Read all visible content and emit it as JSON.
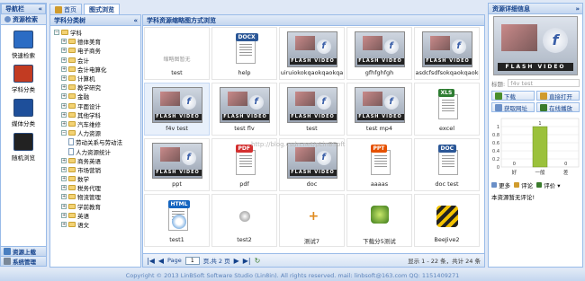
{
  "nav": {
    "title": "导航栏",
    "section": "资源检索",
    "items": [
      {
        "label": "快速检索",
        "color": "#2b6cc4"
      },
      {
        "label": "学科分类",
        "color": "#c23b22"
      },
      {
        "label": "媒体分类",
        "color": "#1e4f9a"
      },
      {
        "label": "随机浏览",
        "color": "#222222"
      }
    ],
    "footer": [
      "资源上载",
      "系统管理"
    ]
  },
  "tabs": [
    {
      "label": "首页"
    },
    {
      "label": "图式浏览"
    }
  ],
  "tree": {
    "title": "学科分类树",
    "nodes": [
      {
        "label": "学科",
        "depth": 0,
        "kind": "folder"
      },
      {
        "label": "德体美育",
        "depth": 1,
        "kind": "folder"
      },
      {
        "label": "电子商务",
        "depth": 1,
        "kind": "folder"
      },
      {
        "label": "会计",
        "depth": 1,
        "kind": "folder"
      },
      {
        "label": "会计电算化",
        "depth": 1,
        "kind": "folder"
      },
      {
        "label": "计算机",
        "depth": 1,
        "kind": "folder"
      },
      {
        "label": "教学研究",
        "depth": 1,
        "kind": "folder"
      },
      {
        "label": "金融",
        "depth": 1,
        "kind": "folder"
      },
      {
        "label": "平面设计",
        "depth": 1,
        "kind": "folder"
      },
      {
        "label": "其他学科",
        "depth": 1,
        "kind": "folder"
      },
      {
        "label": "汽车维修",
        "depth": 1,
        "kind": "folder"
      },
      {
        "label": "人力资源",
        "depth": 1,
        "kind": "folder-open"
      },
      {
        "label": "劳动关系与劳动法",
        "depth": 2,
        "kind": "doc"
      },
      {
        "label": "人力资源统计",
        "depth": 2,
        "kind": "doc"
      },
      {
        "label": "商务英语",
        "depth": 1,
        "kind": "folder"
      },
      {
        "label": "市场营销",
        "depth": 1,
        "kind": "folder"
      },
      {
        "label": "数学",
        "depth": 1,
        "kind": "folder"
      },
      {
        "label": "税务代理",
        "depth": 1,
        "kind": "folder"
      },
      {
        "label": "物流管理",
        "depth": 1,
        "kind": "folder"
      },
      {
        "label": "学前教育",
        "depth": 1,
        "kind": "folder"
      },
      {
        "label": "英语",
        "depth": 1,
        "kind": "folder"
      },
      {
        "label": "语文",
        "depth": 1,
        "kind": "folder"
      }
    ]
  },
  "grid": {
    "title": "学科资源缩略图方式浏览",
    "watermark": "http://blog.csdn.net/pLinBSoft",
    "items": [
      {
        "caption": "test",
        "thumb": "blank",
        "thumb_text": "缩略图暂无"
      },
      {
        "caption": "help",
        "thumb": "docx",
        "thumb_text": "DOCX"
      },
      {
        "caption": "uiruiokokqaokqaokqa",
        "thumb": "flash",
        "thumb_text": "FLASH VIDEO"
      },
      {
        "caption": "gfhfghfgh",
        "thumb": "flash",
        "thumb_text": "FLASH VIDEO"
      },
      {
        "caption": "asdcfsdfsokqaokqaokqa",
        "thumb": "flash",
        "thumb_text": "FLASH VIDEO"
      },
      {
        "caption": "f4v test",
        "thumb": "flash",
        "thumb_text": "FLASH VIDEO",
        "selected": true
      },
      {
        "caption": "test flv",
        "thumb": "flash",
        "thumb_text": "FLASH VIDEO"
      },
      {
        "caption": "test",
        "thumb": "flash",
        "thumb_text": "FLASH VIDEO"
      },
      {
        "caption": "test mp4",
        "thumb": "flash",
        "thumb_text": "FLASH VIDEO"
      },
      {
        "caption": "excel",
        "thumb": "xls",
        "thumb_text": "XLS"
      },
      {
        "caption": "ppt",
        "thumb": "flash",
        "thumb_text": "FLASH VIDEO"
      },
      {
        "caption": "pdf",
        "thumb": "pdf",
        "thumb_text": "PDF"
      },
      {
        "caption": "doc",
        "thumb": "flash",
        "thumb_text": "FLASH VIDEO"
      },
      {
        "caption": "aaaas",
        "thumb": "ppt",
        "thumb_text": "PPT"
      },
      {
        "caption": "doc test",
        "thumb": "doc",
        "thumb_text": "DOC"
      },
      {
        "caption": "test1",
        "thumb": "html",
        "thumb_text": "HTML"
      },
      {
        "caption": "test2",
        "thumb": "ball",
        "thumb_text": ""
      },
      {
        "caption": "测试7",
        "thumb": "plus",
        "thumb_text": ""
      },
      {
        "caption": "下载分5测试",
        "thumb": "app",
        "thumb_text": ""
      },
      {
        "caption": "BeeJive2",
        "thumb": "bee",
        "thumb_text": ""
      }
    ],
    "pager": {
      "page_label": "Page",
      "page_value": "1",
      "of_label": "页,共 2 页",
      "status": "显示 1 - 22 条，共计 24 条"
    }
  },
  "detail": {
    "title": "资源详细信息",
    "preview_text": "FLASH VIDEO",
    "name_label": "标题:",
    "name_value": "f4v test",
    "buttons": [
      {
        "label": "下载"
      },
      {
        "label": "直接打开"
      },
      {
        "label": "获取网址"
      },
      {
        "label": "在线播放"
      }
    ],
    "rating": {
      "categories": [
        "好",
        "一般",
        "差"
      ],
      "values": [
        0,
        1,
        0
      ],
      "ylim": [
        0,
        1.2
      ],
      "ticks": [
        "1",
        "0.8",
        "0.6",
        "0.4",
        "0.2",
        "0"
      ],
      "bar_color": "#9bc13b"
    },
    "actions": [
      "更多",
      "评论",
      "评价"
    ],
    "comment_text": "本资源暂无评论!"
  },
  "footer": {
    "text": "Copyright © 2013 LinBSoft Software Studio (Lin8in). All rights reserved. mail: linbsoft@163.com QQ: 1151409271"
  }
}
